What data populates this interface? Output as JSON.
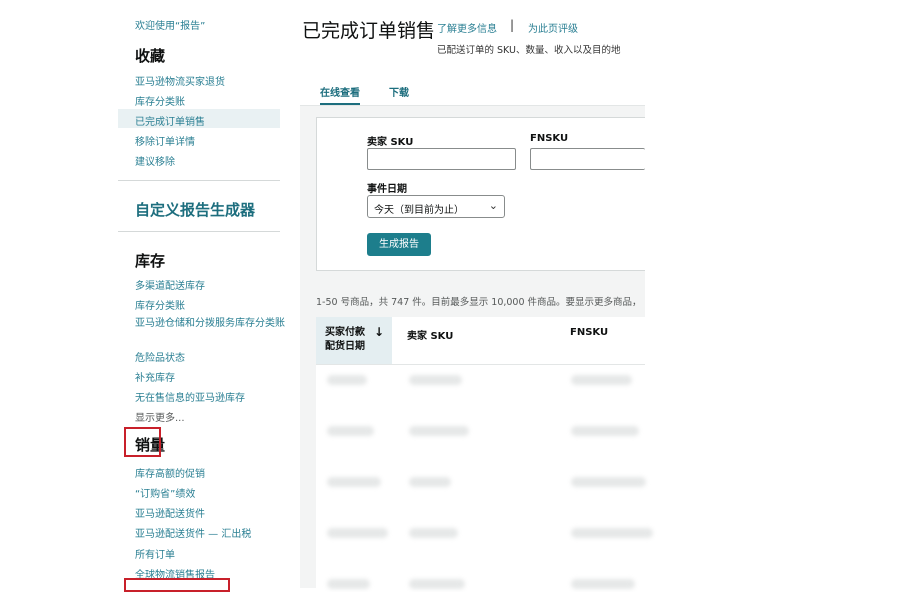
{
  "sidebar": {
    "welcome": "欢迎使用“报告”",
    "favorites_heading": "收藏",
    "favorites": [
      "亚马逊物流买家退货",
      "库存分类账",
      "已完成订单销售",
      "移除订单详情",
      "建议移除"
    ],
    "custom_report_builder": "自定义报告生成器",
    "inventory_heading": "库存",
    "inventory": [
      "多渠道配送库存",
      "库存分类账",
      "亚马逊仓储和分拨服务库存分类账",
      "危险品状态",
      "补充库存",
      "无在售信息的亚马逊库存",
      "显示更多..."
    ],
    "sales_heading": "销量",
    "sales": [
      "库存高额的促销",
      "“订购省”绩效",
      "亚马逊配送货件",
      "亚马逊配送货件 — 汇出税",
      "所有订单",
      "全球物流销售报告"
    ]
  },
  "header": {
    "title": "已完成订单销售",
    "learn_more": "了解更多信息",
    "separator": "|",
    "rate_page": "为此页评级",
    "subtitle": "已配送订单的 SKU、数量、收入以及目的地"
  },
  "tabs": [
    "在线查看",
    "下载"
  ],
  "form": {
    "seller_sku_label": "卖家 SKU",
    "seller_sku_value": "",
    "fnsku_label": "FNSKU",
    "fnsku_value": "",
    "event_date_label": "事件日期",
    "event_date_value": "今天（到目前为止）",
    "generate_button": "生成报告"
  },
  "results": {
    "count_text": "1-50 号商品，共 747 件。目前最多显示 10,000 件商品。要显示更多商品，",
    "columns": [
      "买家付款 配货日期",
      "卖家 SKU",
      "FNSKU"
    ],
    "sort_icon": "arrow-down-icon",
    "row_count": 5
  },
  "colors": {
    "accent": "#1d7e8c",
    "link": "#2a7f93",
    "highlight": "#c8202a"
  }
}
